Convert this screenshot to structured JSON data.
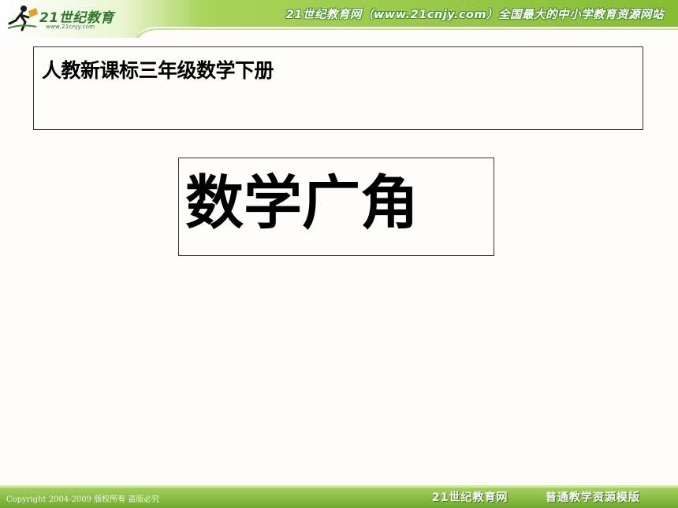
{
  "header": {
    "logo_text": "21世纪教育",
    "logo_url": "www.21cnjy.com",
    "slogan": "21世纪教育网（www.21cnjy.com）全国最大的中小学教育资源网站",
    "logo_icon": "running-person-book-icon"
  },
  "slide": {
    "subtitle": "人教新课标三年级数学下册",
    "title": "数学广角"
  },
  "footer": {
    "copyright": "Copyright 2004-2009 版权所有 盗版必究",
    "brand": "21世纪教育网",
    "template": "普通教学资源模版"
  },
  "colors": {
    "header_green": "#8fc43a",
    "header_light": "#d9eeb0",
    "footer_green": "#7db33a",
    "background": "#fefdf9"
  }
}
